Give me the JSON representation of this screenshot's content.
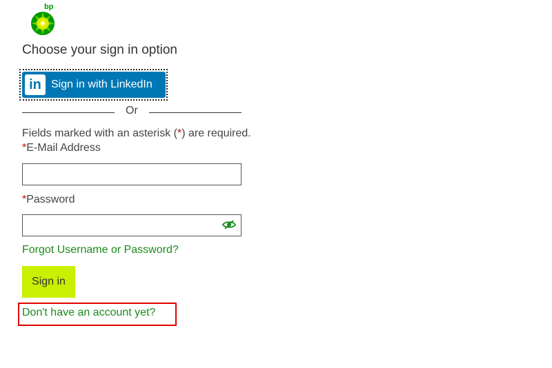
{
  "brand": {
    "logo_text": "bp",
    "logo_icon": "bp-helios-icon",
    "accent_color": "#009900"
  },
  "title": "Choose your sign in option",
  "linkedin": {
    "label": "Sign in with LinkedIn",
    "icon_text": "in",
    "color": "#0077b5"
  },
  "divider_text": "Or",
  "required_note": {
    "prefix": "Fields marked with an asterisk (",
    "asterisk": "*",
    "suffix": ") are required."
  },
  "email": {
    "asterisk": "*",
    "label": "E-Mail Address",
    "value": "",
    "placeholder": ""
  },
  "password": {
    "asterisk": "*",
    "label": "Password",
    "value": "",
    "placeholder": "",
    "toggle_icon": "eye-slash-icon"
  },
  "forgot_link": "Forgot Username or Password?",
  "signin_button": "Sign in",
  "signin_color": "#c8f000",
  "account_link": "Don't have an account yet?",
  "highlight_color": "#e00000"
}
